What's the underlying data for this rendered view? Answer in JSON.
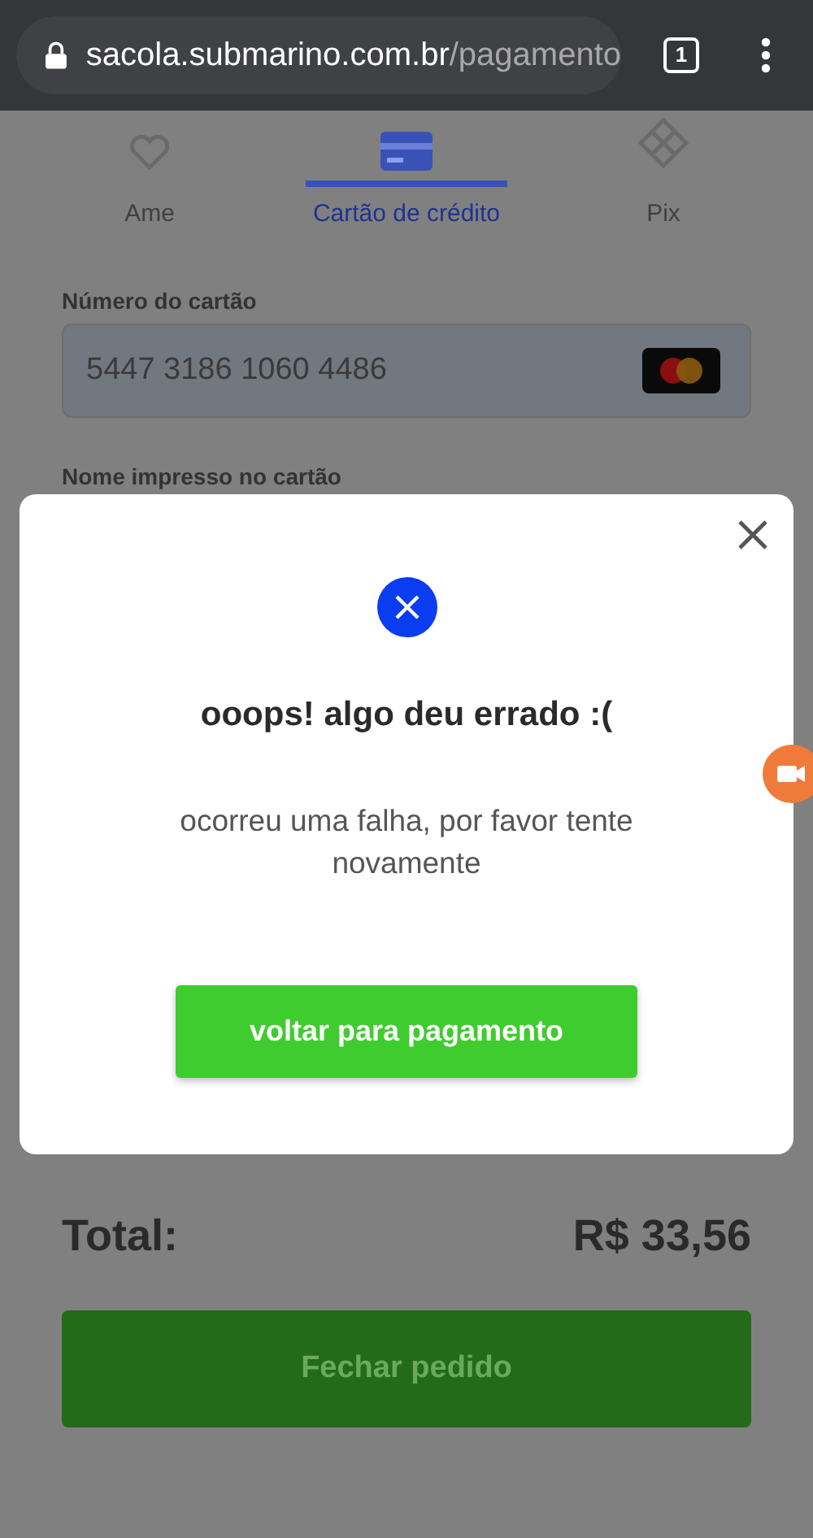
{
  "browser": {
    "url_host": "sacola.submarino.com.br",
    "url_path": "/pagamento",
    "tab_count": "1"
  },
  "payment_tabs": [
    {
      "label": "Ame",
      "kind": "heart",
      "selected": false
    },
    {
      "label": "Cartão de crédito",
      "kind": "card",
      "selected": true
    },
    {
      "label": "Pix",
      "kind": "pix",
      "selected": false
    }
  ],
  "card_number": {
    "label": "Número do cartão",
    "value": "5447 3186 1060 4486"
  },
  "card_name": {
    "label": "Nome impresso no cartão"
  },
  "total": {
    "label": "Total:",
    "value": "R$ 33,56"
  },
  "checkout_button": "Fechar pedido",
  "dialog": {
    "title": "ooops! algo deu errado :(",
    "message": "ocorreu uma falha, por favor tente novamente",
    "button": "voltar para pagamento"
  }
}
